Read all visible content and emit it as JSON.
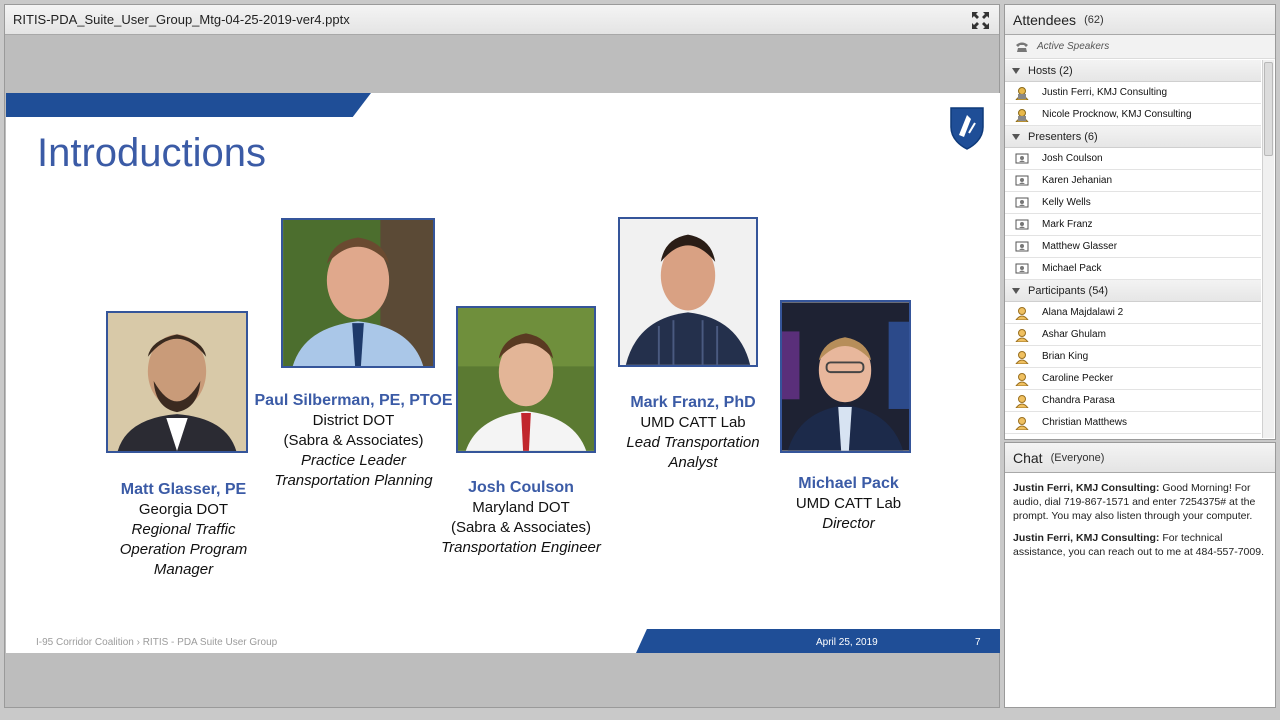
{
  "share": {
    "file_title": "RITIS-PDA_Suite_User_Group_Mtg-04-25-2019-ver4.pptx"
  },
  "slide": {
    "title": "Introductions",
    "people": [
      {
        "name": "Matt Glasser, PE",
        "lines": [
          "Georgia DOT"
        ],
        "roles": [
          "Regional Traffic",
          "Operation Program",
          "Manager"
        ]
      },
      {
        "name": "Paul Silberman, PE, PTOE",
        "lines": [
          "District DOT",
          "(Sabra & Associates)"
        ],
        "roles": [
          "Practice Leader",
          "Transportation Planning"
        ]
      },
      {
        "name": "Josh Coulson",
        "lines": [
          "Maryland DOT",
          "(Sabra & Associates)"
        ],
        "roles": [
          "Transportation Engineer"
        ]
      },
      {
        "name": "Mark Franz, PhD",
        "lines": [
          "UMD CATT Lab"
        ],
        "roles": [
          "Lead Transportation",
          "Analyst"
        ]
      },
      {
        "name": "Michael Pack",
        "lines": [
          "UMD CATT Lab"
        ],
        "roles": [
          "Director"
        ]
      }
    ],
    "footer_left": "I-95 Corridor Coalition › RITIS - PDA Suite User Group",
    "footer_date": "April 25, 2019",
    "footer_page": "7"
  },
  "attendees": {
    "title": "Attendees",
    "count": "(62)",
    "active_speakers": "Active Speakers",
    "hosts_label": "Hosts (2)",
    "hosts": [
      "Justin Ferri, KMJ Consulting",
      "Nicole Procknow, KMJ Consulting"
    ],
    "presenters_label": "Presenters (6)",
    "presenters": [
      "Josh Coulson",
      "Karen Jehanian",
      "Kelly Wells",
      "Mark Franz",
      "Matthew Glasser",
      "Michael Pack"
    ],
    "participants_label": "Participants (54)",
    "participants": [
      "Alana Majdalawi 2",
      "Ashar Ghulam",
      "Brian King",
      "Caroline Pecker",
      "Chandra Parasa",
      "Christian Matthews"
    ]
  },
  "chat": {
    "title": "Chat",
    "scope": "(Everyone)",
    "messages": [
      {
        "who": "Justin Ferri, KMJ Consulting:",
        "text": " Good Morning! For audio, dial 719-867-1571 and enter 7254375# at the prompt. You may also listen through your computer."
      },
      {
        "who": "Justin Ferri, KMJ Consulting:",
        "text": " For technical assistance, you can reach out to me at 484-557-7009."
      }
    ]
  }
}
